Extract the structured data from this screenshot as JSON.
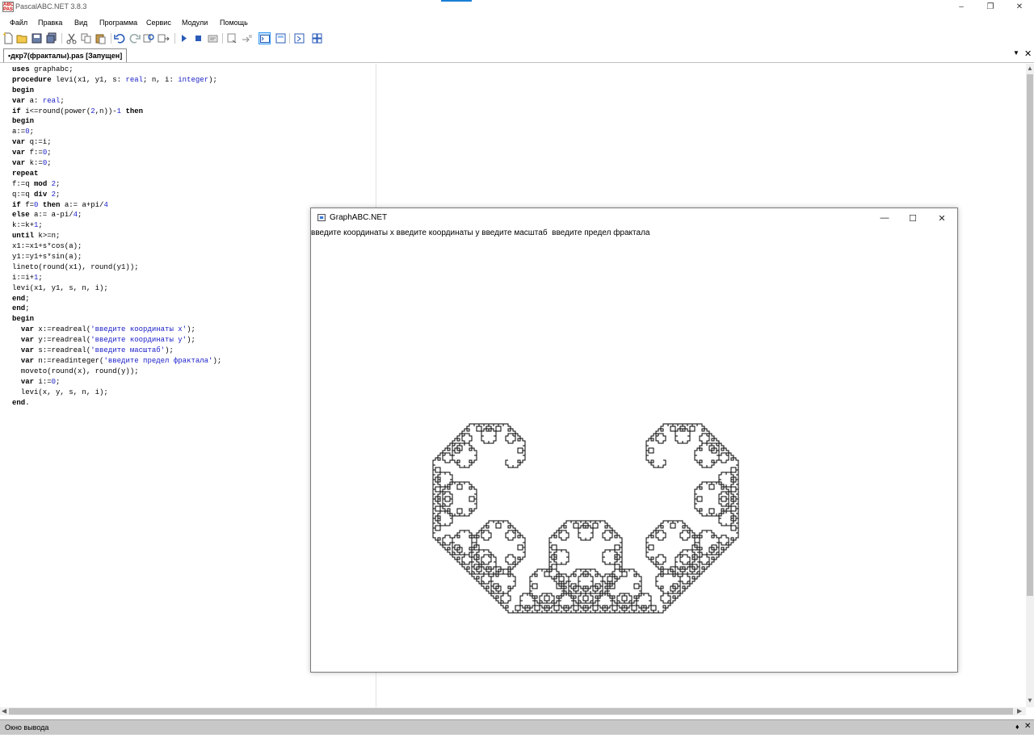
{
  "window": {
    "title": "PascalABC.NET 3.8.3",
    "minimize": "–",
    "restore": "❐",
    "close": "✕"
  },
  "menu": [
    "Файл",
    "Правка",
    "Вид",
    "Программа",
    "Сервис",
    "Модули",
    "Помощь"
  ],
  "toolbar": {
    "icons": [
      "new-file-icon",
      "open-file-icon",
      "save-icon",
      "save-all-icon",
      "cut-icon",
      "copy-icon",
      "paste-icon",
      "undo-icon",
      "redo-icon",
      "find-icon",
      "replace-icon",
      "run-icon",
      "stop-icon",
      "compile-icon",
      "debug-step-icon",
      "debug-over-icon",
      "console-icon",
      "form-designer-icon",
      "program-icon",
      "modules-icon"
    ]
  },
  "tabs": {
    "active": "•дкр7(фракталы).pas [Запущен]",
    "dropdown": "▼",
    "close": "✕"
  },
  "editor": {
    "lines": [
      [
        [
          "kw",
          "uses"
        ],
        [
          "t",
          " graphabc;"
        ]
      ],
      [
        [
          "kw",
          "procedure"
        ],
        [
          "t",
          " levi(x1, y1, s: "
        ],
        [
          "ty",
          "real"
        ],
        [
          "t",
          "; n, i: "
        ],
        [
          "ty",
          "integer"
        ],
        [
          "t",
          ");"
        ]
      ],
      [
        [
          "kw",
          "begin"
        ]
      ],
      [
        [
          "kw",
          "var"
        ],
        [
          "t",
          " a: "
        ],
        [
          "ty",
          "real"
        ],
        [
          "t",
          ";"
        ]
      ],
      [
        [
          "kw",
          "if"
        ],
        [
          "t",
          " i<=round(power("
        ],
        [
          "num",
          "2"
        ],
        [
          "t",
          ",n))-"
        ],
        [
          "num",
          "1"
        ],
        [
          "t",
          " "
        ],
        [
          "kw",
          "then"
        ]
      ],
      [
        [
          "kw",
          "begin"
        ]
      ],
      [
        [
          "t",
          "a:="
        ],
        [
          "num",
          "0"
        ],
        [
          "t",
          ";"
        ]
      ],
      [
        [
          "kw",
          "var"
        ],
        [
          "t",
          " q:=i;"
        ]
      ],
      [
        [
          "kw",
          "var"
        ],
        [
          "t",
          " f:="
        ],
        [
          "num",
          "0"
        ],
        [
          "t",
          ";"
        ]
      ],
      [
        [
          "kw",
          "var"
        ],
        [
          "t",
          " k:="
        ],
        [
          "num",
          "0"
        ],
        [
          "t",
          ";"
        ]
      ],
      [
        [
          "kw",
          "repeat"
        ]
      ],
      [
        [
          "t",
          "f:=q "
        ],
        [
          "kw",
          "mod"
        ],
        [
          "t",
          " "
        ],
        [
          "num",
          "2"
        ],
        [
          "t",
          ";"
        ]
      ],
      [
        [
          "t",
          "q:=q "
        ],
        [
          "kw",
          "div"
        ],
        [
          "t",
          " "
        ],
        [
          "num",
          "2"
        ],
        [
          "t",
          ";"
        ]
      ],
      [
        [
          "kw",
          "if"
        ],
        [
          "t",
          " f="
        ],
        [
          "num",
          "0"
        ],
        [
          "t",
          " "
        ],
        [
          "kw",
          "then"
        ],
        [
          "t",
          " a:= a+pi/"
        ],
        [
          "num",
          "4"
        ]
      ],
      [
        [
          "kw",
          "else"
        ],
        [
          "t",
          " a:= a-pi/"
        ],
        [
          "num",
          "4"
        ],
        [
          "t",
          ";"
        ]
      ],
      [
        [
          "t",
          "k:=k+"
        ],
        [
          "num",
          "1"
        ],
        [
          "t",
          ";"
        ]
      ],
      [
        [
          "kw",
          "until"
        ],
        [
          "t",
          " k>=n;"
        ]
      ],
      [
        [
          "t",
          "x1:=x1+s*cos(a);"
        ]
      ],
      [
        [
          "t",
          "y1:=y1+s*sin(a);"
        ]
      ],
      [
        [
          "t",
          "lineto(round(x1), round(y1));"
        ]
      ],
      [
        [
          "t",
          "i:=i+"
        ],
        [
          "num",
          "1"
        ],
        [
          "t",
          ";"
        ]
      ],
      [
        [
          "t",
          "levi(x1, y1, s, n, i);"
        ]
      ],
      [
        [
          "kw",
          "end"
        ],
        [
          "t",
          ";"
        ]
      ],
      [
        [
          "kw",
          "end"
        ],
        [
          "t",
          ";"
        ]
      ],
      [
        [
          "kw",
          "begin"
        ]
      ],
      [
        [
          "t",
          "  "
        ],
        [
          "kw",
          "var"
        ],
        [
          "t",
          " x:=readreal("
        ],
        [
          "str",
          "'введите координаты x'"
        ],
        [
          "t",
          ");"
        ]
      ],
      [
        [
          "t",
          "  "
        ],
        [
          "kw",
          "var"
        ],
        [
          "t",
          " y:=readreal("
        ],
        [
          "str",
          "'введите координаты y'"
        ],
        [
          "t",
          ");"
        ]
      ],
      [
        [
          "t",
          "  "
        ],
        [
          "kw",
          "var"
        ],
        [
          "t",
          " s:=readreal("
        ],
        [
          "str",
          "'введите масштаб'"
        ],
        [
          "t",
          ");"
        ]
      ],
      [
        [
          "t",
          "  "
        ],
        [
          "kw",
          "var"
        ],
        [
          "t",
          " n:=readinteger("
        ],
        [
          "str",
          "'введите предел фрактала'"
        ],
        [
          "t",
          ");"
        ]
      ],
      [
        [
          "t",
          "  moveto(round(x), round(y));"
        ]
      ],
      [
        [
          "t",
          "  "
        ],
        [
          "kw",
          "var"
        ],
        [
          "t",
          " i:="
        ],
        [
          "num",
          "0"
        ],
        [
          "t",
          ";"
        ]
      ],
      [
        [
          "t",
          "  levi(x, y, s, n, i);"
        ]
      ],
      [
        [
          "kw",
          "end"
        ],
        [
          "t",
          "."
        ]
      ]
    ]
  },
  "graph_window": {
    "title": "GraphABC.NET",
    "minimize": "—",
    "maximize": "☐",
    "close": "✕",
    "prompt": "введите координаты x введите координаты y введите масштаб  введите предел фрактала"
  },
  "output": {
    "title": "Окно вывода",
    "pin": "♦",
    "close": "✕"
  },
  "colors": {
    "keyword": "#000000",
    "type": "#1e22c8",
    "string": "#1e22c8",
    "number": "#1e22c8",
    "output_header": "#c8c8c8",
    "accent": "#3399ff"
  }
}
